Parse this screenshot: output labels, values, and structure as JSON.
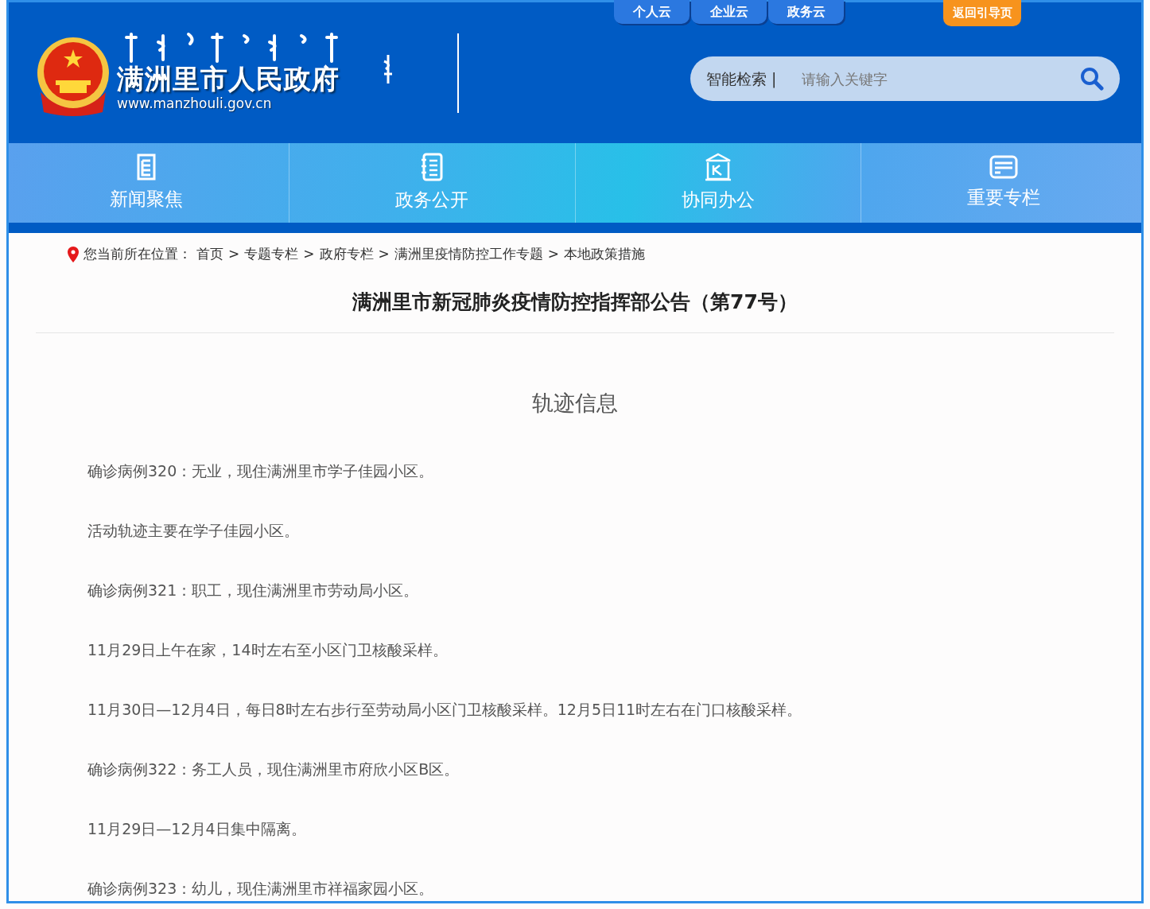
{
  "top_links": [
    {
      "label": "个人云"
    },
    {
      "label": "企业云"
    },
    {
      "label": "政务云"
    }
  ],
  "guide_button": "返回引导页",
  "site": {
    "name": "满洲里市人民政府",
    "url": "www.manzhouli.gov.cn"
  },
  "search": {
    "label": "智能检索 |",
    "placeholder": "请输入关键字"
  },
  "nav": [
    {
      "label": "新闻聚焦"
    },
    {
      "label": "政务公开"
    },
    {
      "label": "协同办公"
    },
    {
      "label": "重要专栏"
    }
  ],
  "breadcrumb": {
    "prefix": "您当前所在位置：",
    "items": [
      {
        "label": "首页",
        "separator": ">"
      },
      {
        "label": "专题专栏",
        "separator": ">"
      },
      {
        "label": "政府专栏",
        "separator": ">"
      },
      {
        "label": "满洲里疫情防控工作专题",
        "separator": ">"
      },
      {
        "label": "本地政策措施"
      }
    ]
  },
  "article": {
    "title": "满洲里市新冠肺炎疫情防控指挥部公告（第77号）",
    "section": "轨迹信息",
    "paragraphs": [
      "确诊病例320：无业，现住满洲里市学子佳园小区。",
      "活动轨迹主要在学子佳园小区。",
      "确诊病例321：职工，现住满洲里市劳动局小区。",
      "11月29日上午在家，14时左右至小区门卫核酸采样。",
      "11月30日—12月4日，每日8时左右步行至劳动局小区门卫核酸采样。12月5日11时左右在门口核酸采样。",
      "确诊病例322：务工人员，现住满洲里市府欣小区B区。",
      "11月29日—12月4日集中隔离。",
      "确诊病例323：幼儿，现住满洲里市祥福家园小区。"
    ]
  }
}
